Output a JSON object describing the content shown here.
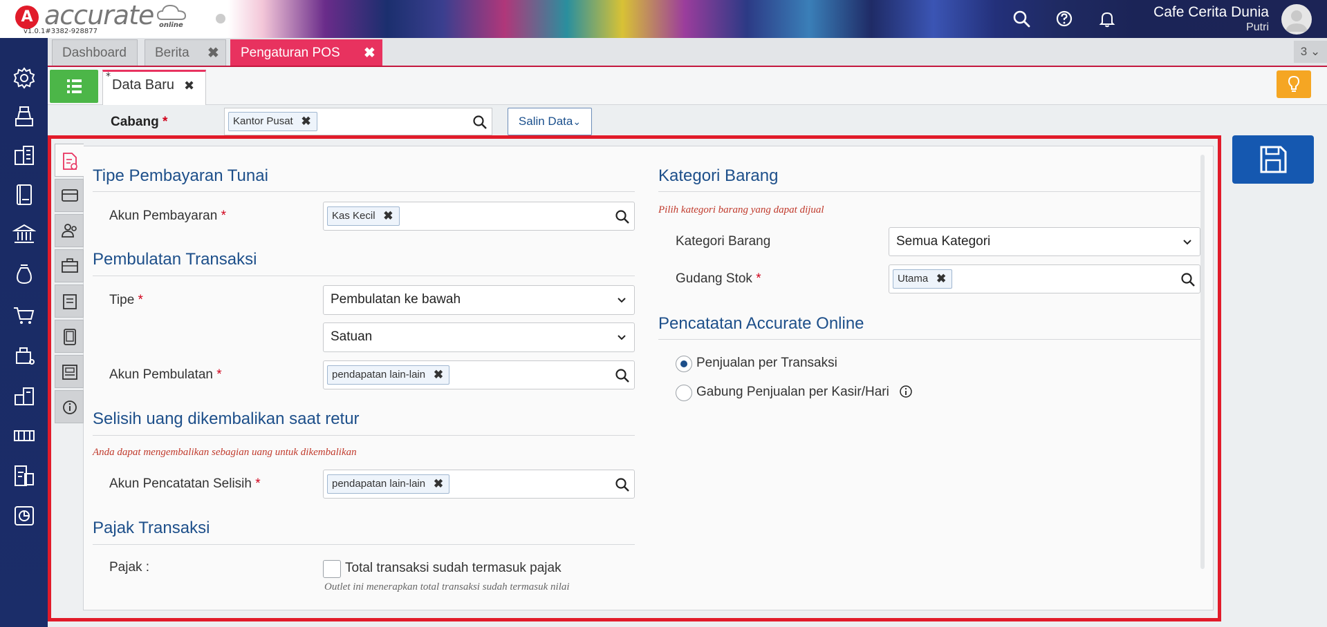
{
  "app": {
    "logo_letter": "A",
    "logo_word": "accurate",
    "logo_sub": "online",
    "version": "v1.0.1#3382-928877",
    "company": "Cafe Cerita Dunia",
    "user": "Putri"
  },
  "tabs": [
    {
      "label": "Dashboard",
      "closable": false,
      "active": false
    },
    {
      "label": "Berita",
      "closable": true,
      "active": false
    },
    {
      "label": "Pengaturan POS",
      "closable": true,
      "active": true
    }
  ],
  "tab_count": "3",
  "subtab": {
    "label": "Data Baru",
    "modified_marker": "*"
  },
  "cabang": {
    "label": "Cabang",
    "required": "*",
    "chip": "Kantor Pusat",
    "salin_label": "Salin Data"
  },
  "left": {
    "tunai": {
      "title": "Tipe Pembayaran Tunai",
      "akun_label": "Akun Pembayaran",
      "akun_chip": "Kas Kecil"
    },
    "pembulatan": {
      "title": "Pembulatan Transaksi",
      "tipe_label": "Tipe",
      "tipe_value": "Pembulatan ke bawah",
      "satuan_value": "Satuan",
      "akun_label": "Akun Pembulatan",
      "akun_chip": "pendapatan lain-lain"
    },
    "selisih": {
      "title": "Selisih uang dikembalikan saat retur",
      "hint": "Anda dapat mengembalikan sebagian uang untuk dikembalikan",
      "akun_label": "Akun Pencatatan Selisih",
      "akun_chip": "pendapatan lain-lain"
    },
    "pajak": {
      "title": "Pajak Transaksi",
      "label": "Pajak :",
      "checkbox_label": "Total transaksi sudah termasuk pajak",
      "checked": false,
      "hint": "Outlet ini menerapkan total transaksi sudah termasuk nilai"
    }
  },
  "right": {
    "kategori": {
      "title": "Kategori Barang",
      "hint": "Pilih kategori barang yang dapat dijual",
      "kategori_label": "Kategori Barang",
      "kategori_value": "Semua Kategori",
      "gudang_label": "Gudang Stok",
      "gudang_chip": "Utama"
    },
    "pencatatan": {
      "title": "Pencatatan Accurate Online",
      "options": [
        {
          "label": "Penjualan per Transaksi",
          "selected": true
        },
        {
          "label": "Gabung Penjualan per Kasir/Hari",
          "selected": false
        }
      ]
    }
  },
  "icons": {
    "top": [
      "search-icon",
      "help-icon",
      "bell-icon"
    ],
    "sidebar": [
      "gear-icon",
      "cash-register-icon",
      "building-icon",
      "ledger-icon",
      "bank-icon",
      "money-bag-icon",
      "cart-icon",
      "purchase-icon",
      "inventory-icon",
      "manufacturing-icon",
      "tax-icon",
      "report-icon"
    ],
    "vtabs": [
      "document-icon",
      "payment-icon",
      "users-icon",
      "briefcase-icon",
      "receipt-icon",
      "device-icon",
      "printer-icon",
      "info-icon"
    ]
  },
  "colors": {
    "accent_pink": "#e8325f",
    "section_blue": "#1d4f8a",
    "save_blue": "#1558b0",
    "frame_red": "#e11b2a",
    "sidebar_navy": "#1a2a63",
    "list_green": "#4cb648",
    "bulb_orange": "#f5a623",
    "hint_red": "#c0392b"
  }
}
